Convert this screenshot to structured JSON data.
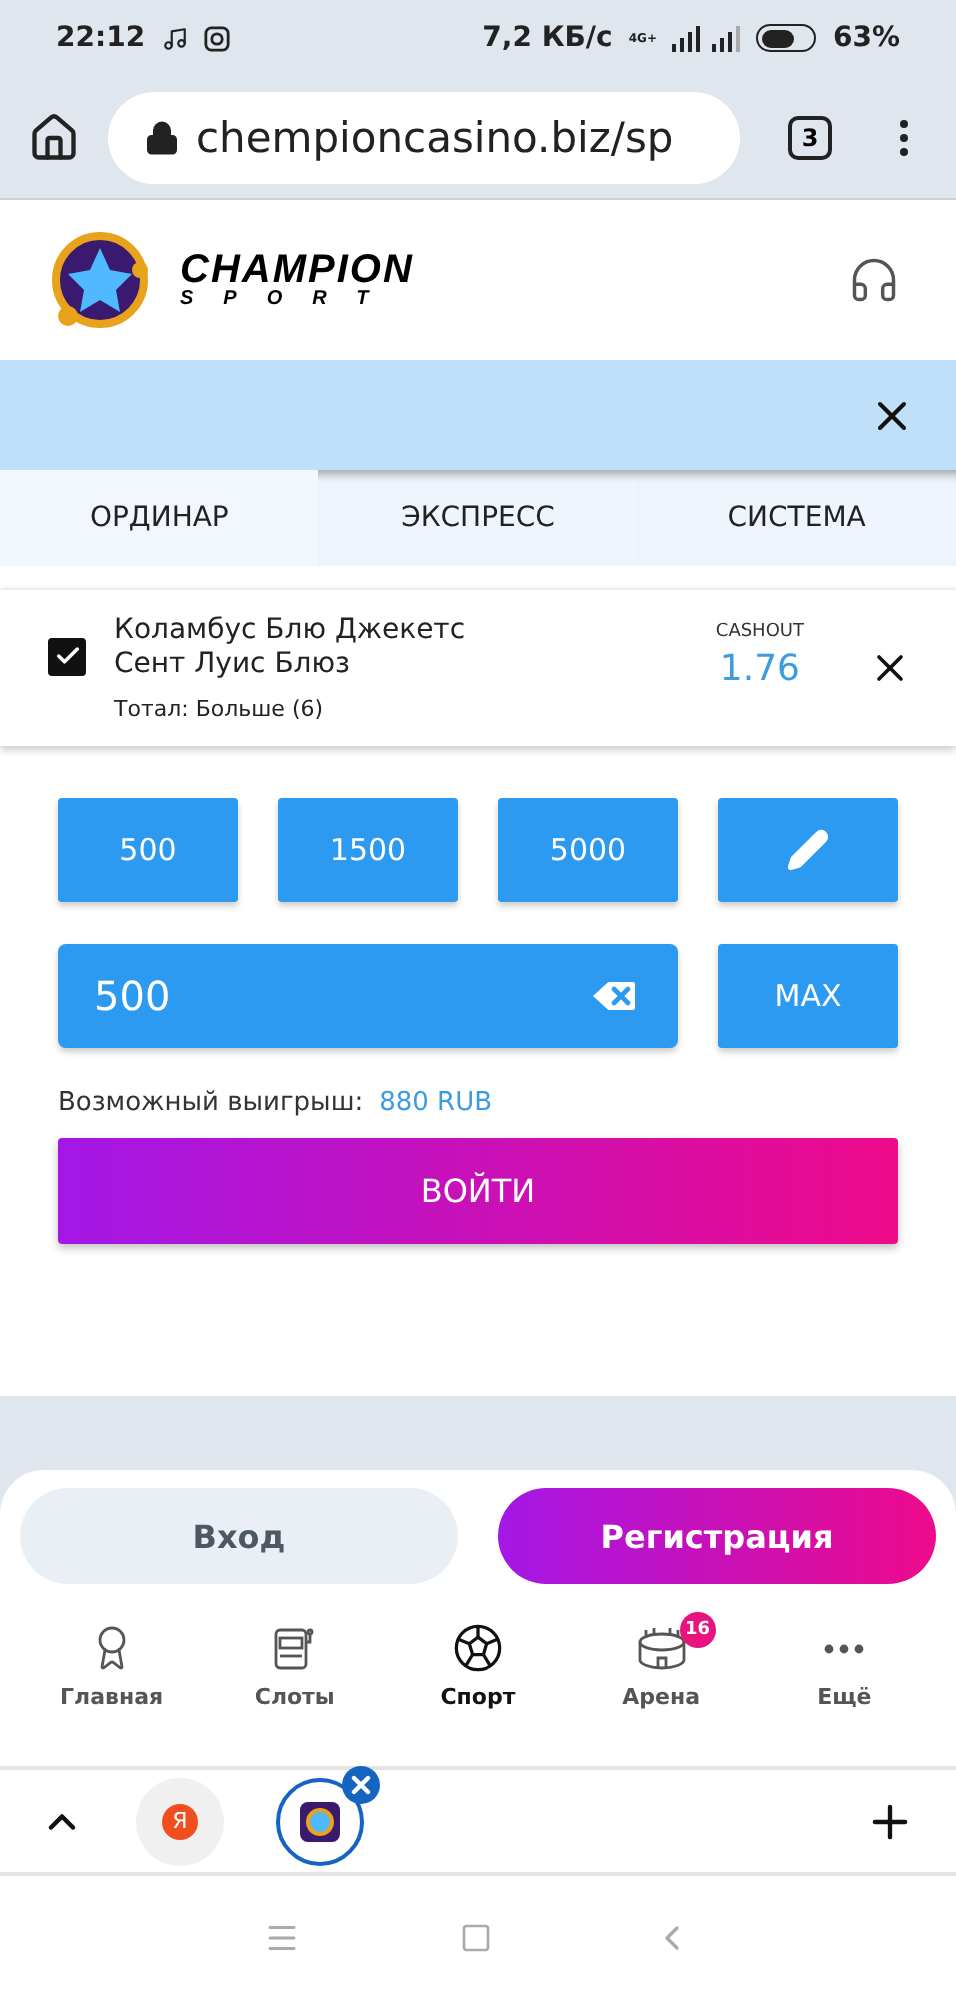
{
  "status_bar": {
    "time": "22:12",
    "speed": "7,2 КБ/с",
    "network": "4G+",
    "battery": "63%"
  },
  "browser": {
    "url": "chempioncasino.biz/sp",
    "tab_count": "3"
  },
  "header": {
    "brand": "CHAMPION",
    "sub": "SPORT"
  },
  "bet_types": [
    {
      "label": "ОРДИНАР",
      "selected": true
    },
    {
      "label": "ЭКСПРЕСС",
      "selected": false
    },
    {
      "label": "СИСТЕМА",
      "selected": false
    }
  ],
  "bet": {
    "checked": true,
    "teams": [
      "Коламбус Блю Джекетс",
      "Сент Луис Блюз"
    ],
    "market": "Тотал: Больше (6)",
    "cashout_label": "CASHOUT",
    "odds": "1.76"
  },
  "quick_stakes": [
    "500",
    "1500",
    "5000"
  ],
  "stake": {
    "value": "500",
    "max_label": "MAX"
  },
  "possible_win": {
    "label": "Возможный выигрыш:",
    "amount": "880 RUB"
  },
  "submit_label": "ВОЙТИ",
  "auth": {
    "login": "Вход",
    "register": "Регистрация"
  },
  "nav": [
    {
      "label": "Главная",
      "kind": "laurel",
      "selected": false
    },
    {
      "label": "Слоты",
      "kind": "slot",
      "selected": false
    },
    {
      "label": "Спорт",
      "kind": "ball",
      "selected": true
    },
    {
      "label": "Арена",
      "kind": "arena",
      "selected": false,
      "badge": "16"
    },
    {
      "label": "Ещё",
      "kind": "more",
      "selected": false
    }
  ],
  "browser_tabs": [
    {
      "kind": "yandex",
      "letter": "Я",
      "selected": false
    },
    {
      "kind": "site",
      "selected": true
    }
  ]
}
